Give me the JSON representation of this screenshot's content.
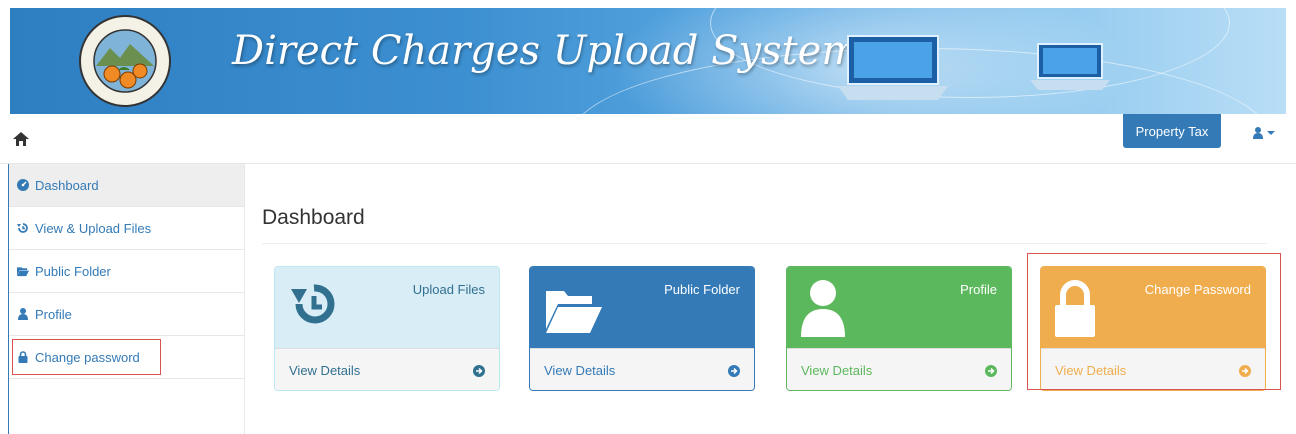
{
  "banner": {
    "title": "Direct Charges Upload System",
    "seal_text": "COUNTY OF ORANGE CALIFORNIA"
  },
  "navbar": {
    "property_tax_label": "Property Tax"
  },
  "sidebar": {
    "items": [
      {
        "label": "Dashboard",
        "icon": "dashboard-icon"
      },
      {
        "label": "View & Upload Files",
        "icon": "history-icon"
      },
      {
        "label": "Public Folder",
        "icon": "folder-open-icon"
      },
      {
        "label": "Profile",
        "icon": "user-icon"
      },
      {
        "label": "Change password",
        "icon": "lock-icon"
      }
    ]
  },
  "main": {
    "title": "Dashboard",
    "panels": [
      {
        "label": "Upload Files",
        "footer": "View Details",
        "icon": "history-icon",
        "color": "#d9edf7"
      },
      {
        "label": "Public Folder",
        "footer": "View Details",
        "icon": "folder-open-icon",
        "color": "#337ab7"
      },
      {
        "label": "Profile",
        "footer": "View Details",
        "icon": "user-icon",
        "color": "#5cb85c"
      },
      {
        "label": "Change Password",
        "footer": "View Details",
        "icon": "lock-icon",
        "color": "#f0ad4e"
      }
    ]
  },
  "colors": {
    "primary": "#337ab7",
    "success": "#5cb85c",
    "warning": "#f0ad4e",
    "info": "#d9edf7",
    "highlight": "#d9534f"
  }
}
